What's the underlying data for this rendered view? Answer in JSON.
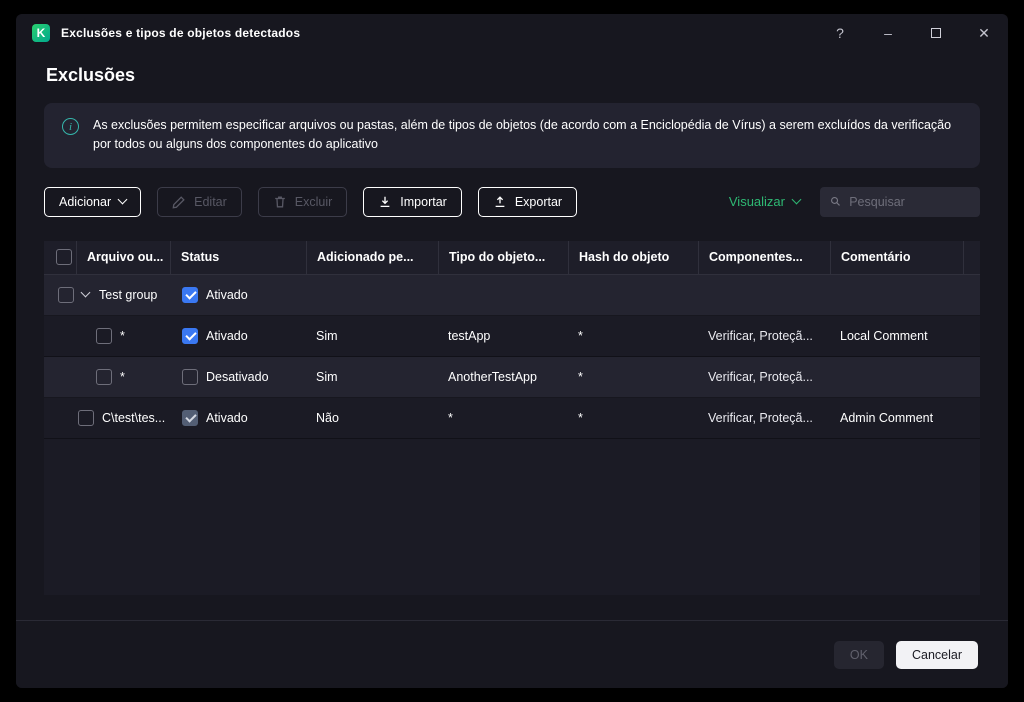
{
  "window": {
    "title": "Exclusões e tipos de objetos detectados"
  },
  "titlebar": {
    "help": "?",
    "minimize": "–",
    "close": "✕"
  },
  "icons": {
    "kaspersky-logo": "K",
    "info": "i",
    "maximize": "square-outline",
    "search": "magnifier",
    "edit": "pencil",
    "delete": "trash",
    "import": "arrow-down-tray",
    "export": "arrow-up-tray",
    "chevron": "chevron-down"
  },
  "page": {
    "heading": "Exclusões",
    "info_text": "As exclusões permitem especificar arquivos ou pastas, além de tipos de objetos (de acordo com a Enciclopédia de Vírus) a serem excluídos da verificação por todos ou alguns dos componentes do aplicativo"
  },
  "toolbar": {
    "add_label": "Adicionar",
    "edit_label": "Editar",
    "delete_label": "Excluir",
    "import_label": "Importar",
    "export_label": "Exportar",
    "view_label": "Visualizar",
    "search_placeholder": "Pesquisar"
  },
  "table": {
    "columns": [
      "Arquivo ou...",
      "Status",
      "Adicionado pe...",
      "Tipo do objeto...",
      "Hash do objeto",
      "Componentes...",
      "Comentário"
    ],
    "group_row": {
      "name": "Test group",
      "status": "Ativado",
      "checked": true
    },
    "rows": [
      {
        "file": "*",
        "status": "Ativado",
        "checked": true,
        "muted": false,
        "added_by": "Sim",
        "object_type": "testApp",
        "hash": "*",
        "components": "Verificar, Proteçã...",
        "comment": "Local Comment"
      },
      {
        "file": "*",
        "status": "Desativado",
        "checked": false,
        "muted": false,
        "added_by": "Sim",
        "object_type": "AnotherTestApp",
        "hash": "*",
        "components": "Verificar, Proteçã...",
        "comment": ""
      },
      {
        "file": "C\\test\\tes...",
        "status": "Ativado",
        "checked": true,
        "muted": true,
        "added_by": "Não",
        "object_type": "*",
        "hash": "*",
        "components": "Verificar, Proteçã...",
        "comment": "Admin Comment"
      }
    ]
  },
  "footer": {
    "ok_label": "OK",
    "cancel_label": "Cancelar"
  },
  "colors": {
    "accent_blue": "#3a78f2",
    "accent_green": "#2eb873",
    "info_teal": "#35b5aa",
    "window_bg": "#17171f",
    "banner_bg": "#232330"
  }
}
